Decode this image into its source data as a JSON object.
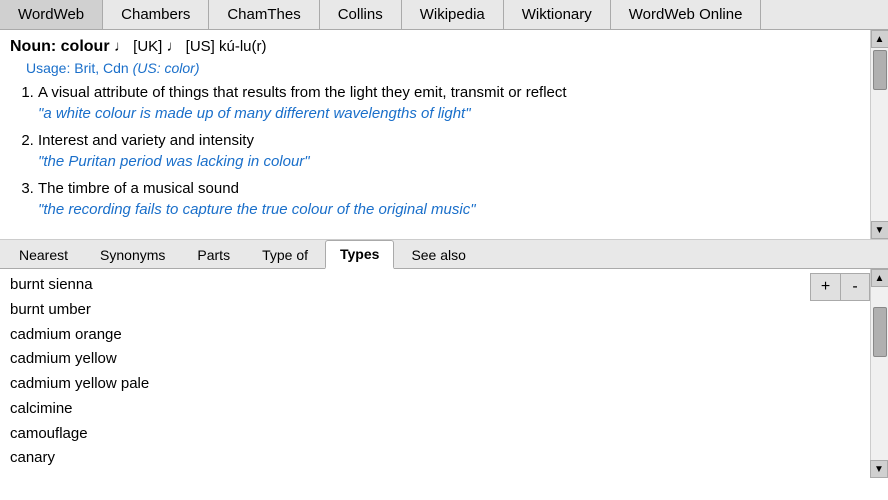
{
  "tabs": [
    {
      "label": "WordWeb",
      "active": false
    },
    {
      "label": "Chambers",
      "active": false
    },
    {
      "label": "ChamThes",
      "active": false
    },
    {
      "label": "Collins",
      "active": false
    },
    {
      "label": "Wikipedia",
      "active": false
    },
    {
      "label": "Wiktionary",
      "active": false
    },
    {
      "label": "WordWeb Online",
      "active": false
    }
  ],
  "header": {
    "noun_label": "Noun: colour",
    "uk_phonetic": "♩ [UK]",
    "us_phonetic": "♩ [US]",
    "pronunciation": "kú-lu(r)",
    "usage": "Usage: Brit, Cdn",
    "usage_note": "(US: color)"
  },
  "definitions": [
    {
      "number": 1,
      "text": "A visual attribute of things that results from the light they emit, transmit or reflect",
      "example": "\"a white colour is made up of many different wavelengths of light\""
    },
    {
      "number": 2,
      "text": "Interest and variety and intensity",
      "example": "\"the Puritan period was lacking in colour\""
    },
    {
      "number": 3,
      "text": "The timbre of a musical sound",
      "example": "\"the recording fails to capture the true colour of the original music\""
    }
  ],
  "bottom_tabs": [
    {
      "label": "Nearest",
      "active": false
    },
    {
      "label": "Synonyms",
      "active": false
    },
    {
      "label": "Parts",
      "active": false
    },
    {
      "label": "Type of",
      "active": false
    },
    {
      "label": "Types",
      "active": true
    },
    {
      "label": "See also",
      "active": false
    }
  ],
  "list_items": [
    "burnt sienna",
    "burnt umber",
    "cadmium orange",
    "cadmium yellow",
    "cadmium yellow pale",
    "calcimine",
    "camouflage",
    "canary"
  ],
  "controls": {
    "plus_label": "+",
    "minus_label": "-"
  }
}
